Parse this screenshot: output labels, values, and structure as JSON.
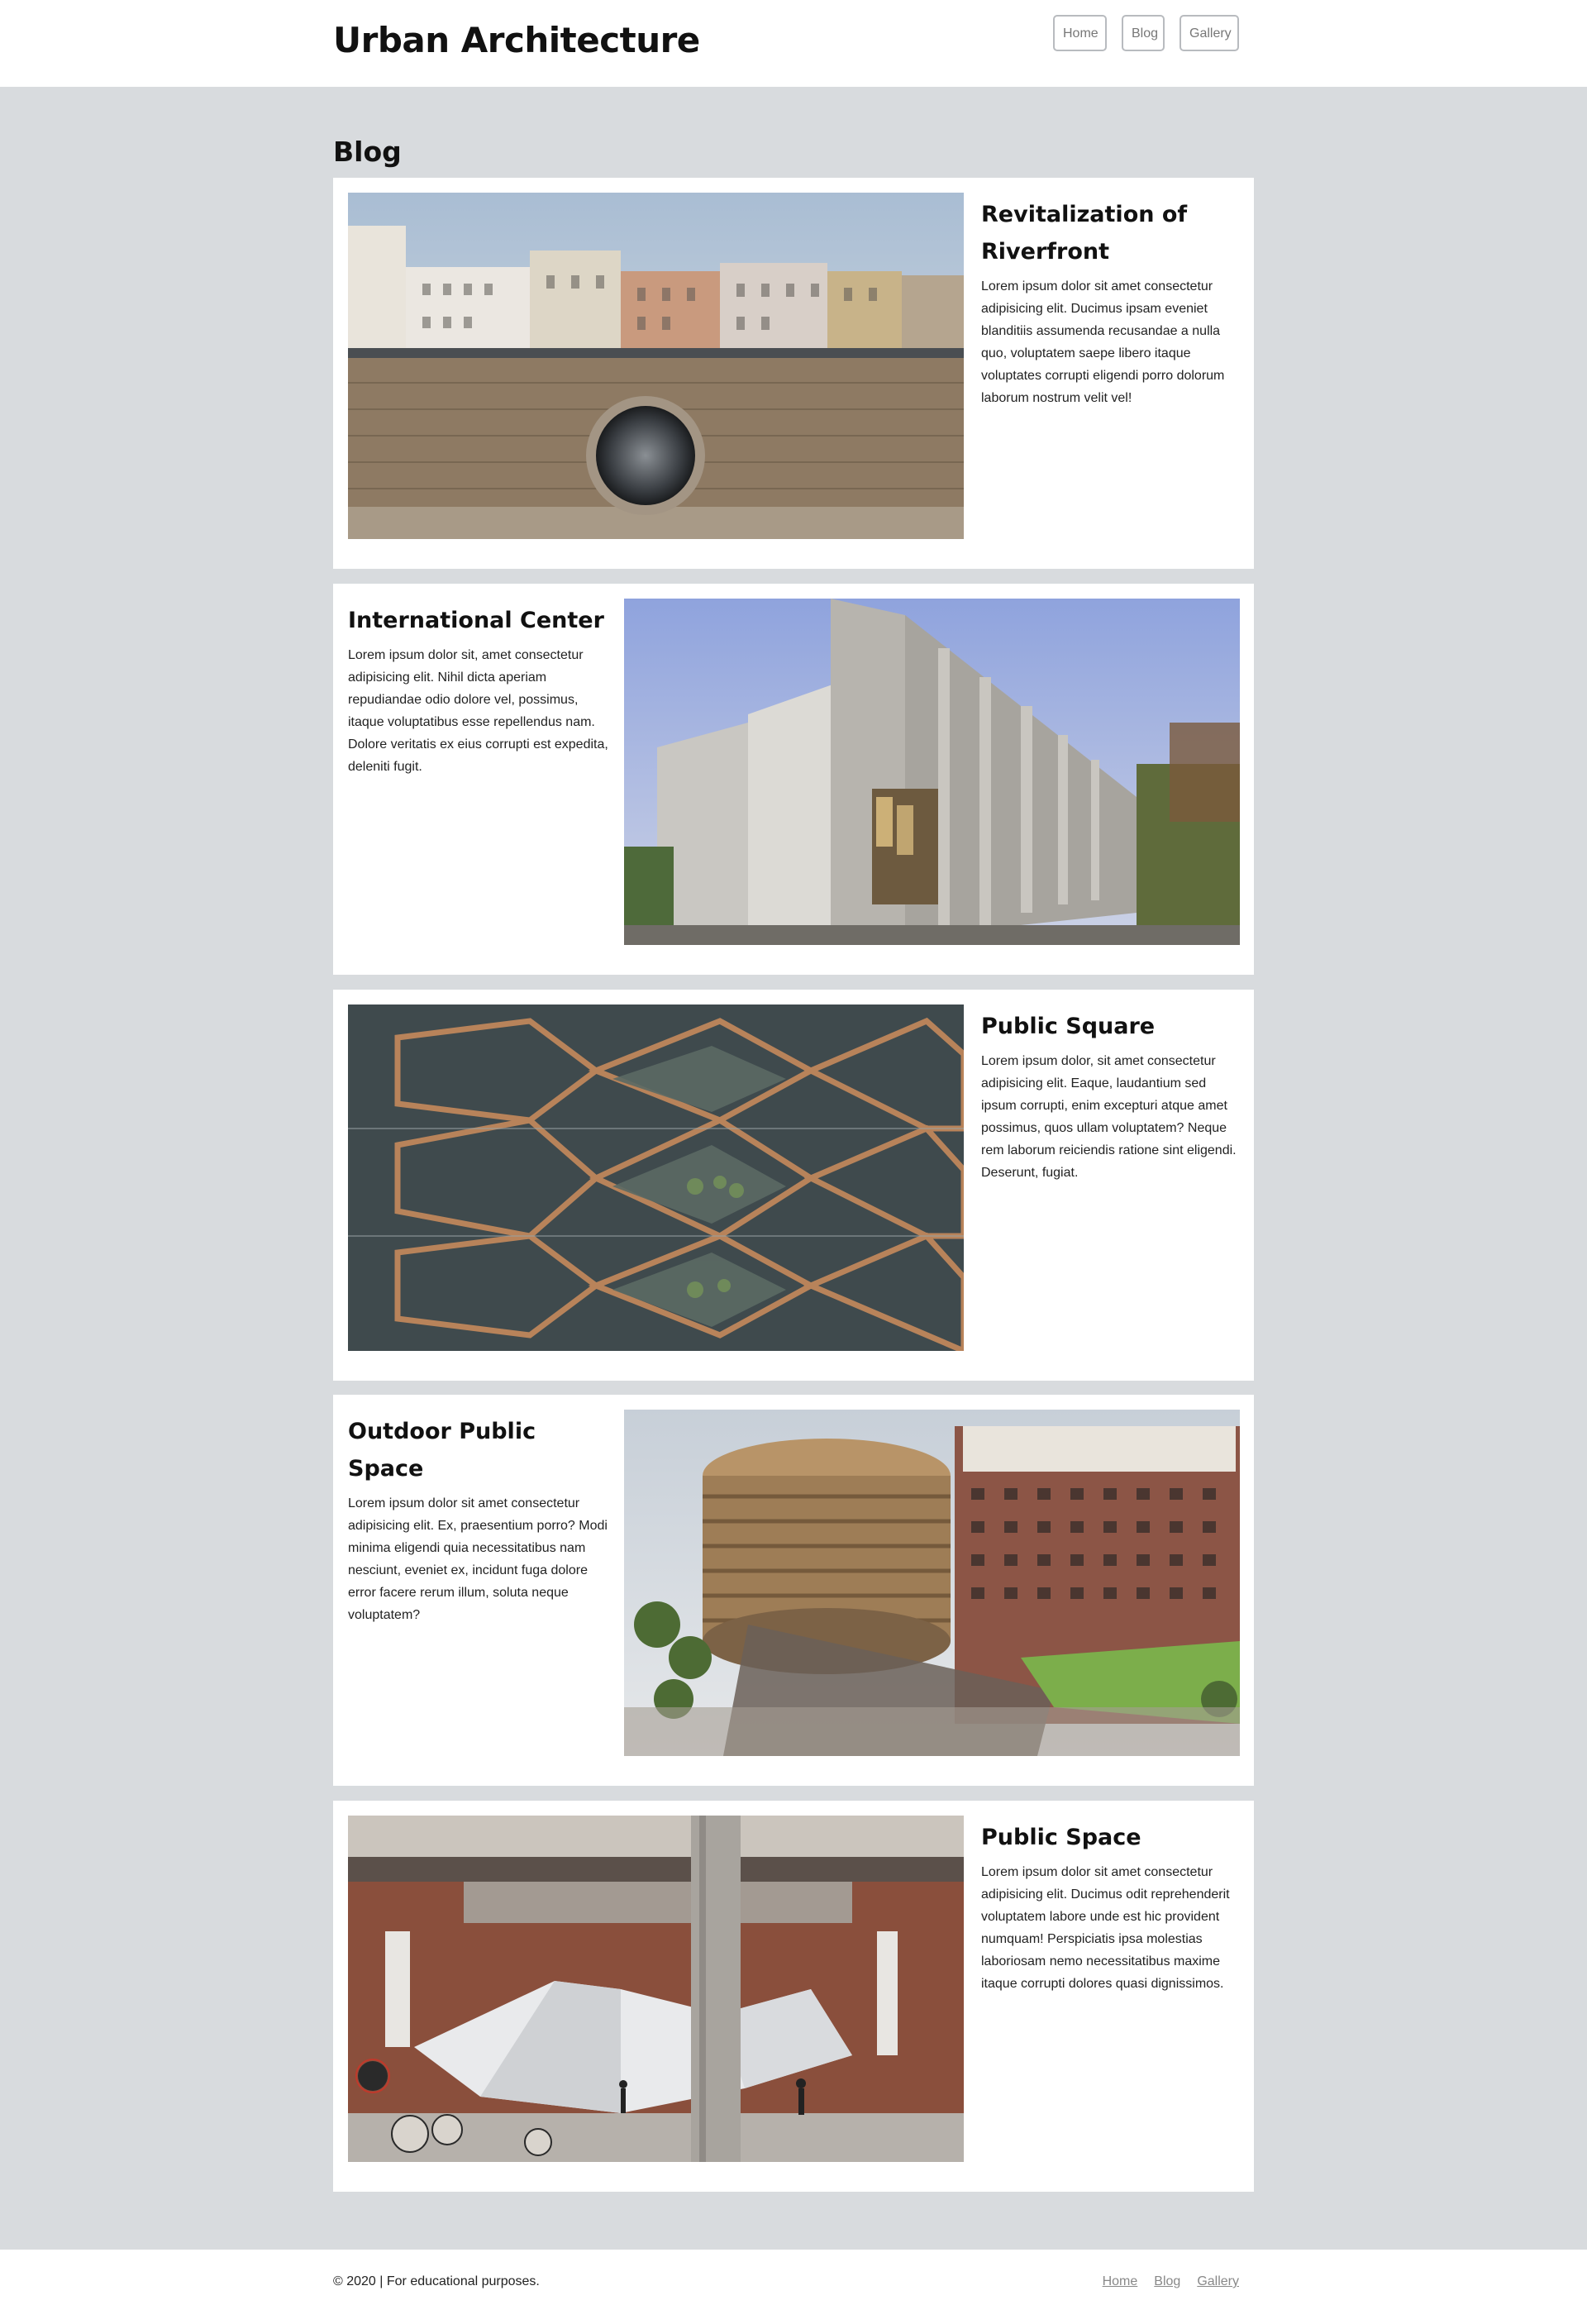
{
  "header": {
    "site_title": "Urban Architecture",
    "nav": [
      "Home",
      "Blog",
      "Gallery"
    ]
  },
  "page": {
    "heading": "Blog"
  },
  "posts": [
    {
      "title": "Revitalization of Riverfront",
      "body": "Lorem ipsum dolor sit amet consectetur adipisicing elit. Ducimus ipsam eveniet blanditiis assumenda recusandae a nulla quo, voluptatem saepe libero itaque voluptates corrupti eligendi porro dolorum laborum nostrum velit vel!",
      "image": "riverfront-wall-porthole-photo",
      "image_side": "left"
    },
    {
      "title": "International Center",
      "body": "Lorem ipsum dolor sit, amet consectetur adipisicing elit. Nihil dicta aperiam repudiandae odio dolore vel, possimus, itaque voluptatibus esse repellendus nam. Dolore veritatis ex eius corrupti est expedita, deleniti fugit.",
      "image": "concrete-building-photo",
      "image_side": "right"
    },
    {
      "title": "Public Square",
      "body": "Lorem ipsum dolor, sit amet consectetur adipisicing elit. Eaque, laudantium sed ipsum corrupti, enim excepturi atque amet possimus, quos ullam voluptatem? Neque rem laborum reiciendis ratione sint eligendi. Deserunt, fugiat.",
      "image": "honeycomb-staircase-photo",
      "image_side": "left"
    },
    {
      "title": "Outdoor Public Space",
      "body": "Lorem ipsum dolor sit amet consectetur adipisicing elit. Ex, praesentium porro? Modi minima eligendi quia necessitatibus nam nesciunt, eveniet ex, incidunt fuga dolore error facere rerum illum, soluta neque voluptatem?",
      "image": "round-timber-building-photo",
      "image_side": "right"
    },
    {
      "title": "Public Space",
      "body": "Lorem ipsum dolor sit amet consectetur adipisicing elit. Ducimus odit reprehenderit voluptatem labore unde est hic provident numquam! Perspiciatis ipsa molestias laboriosam nemo necessitatibus maxime itaque corrupti dolores quasi dignissimos.",
      "image": "brick-hall-installation-photo",
      "image_side": "left"
    }
  ],
  "footer": {
    "copyright": "© 2020 | For educational purposes.",
    "links": [
      "Home",
      "Blog",
      "Gallery"
    ]
  },
  "colors": {
    "page_background": "#d8dbde",
    "surface": "#ffffff",
    "text": "#111111",
    "nav_border": "#b8bbbf",
    "muted_link": "#888888"
  }
}
